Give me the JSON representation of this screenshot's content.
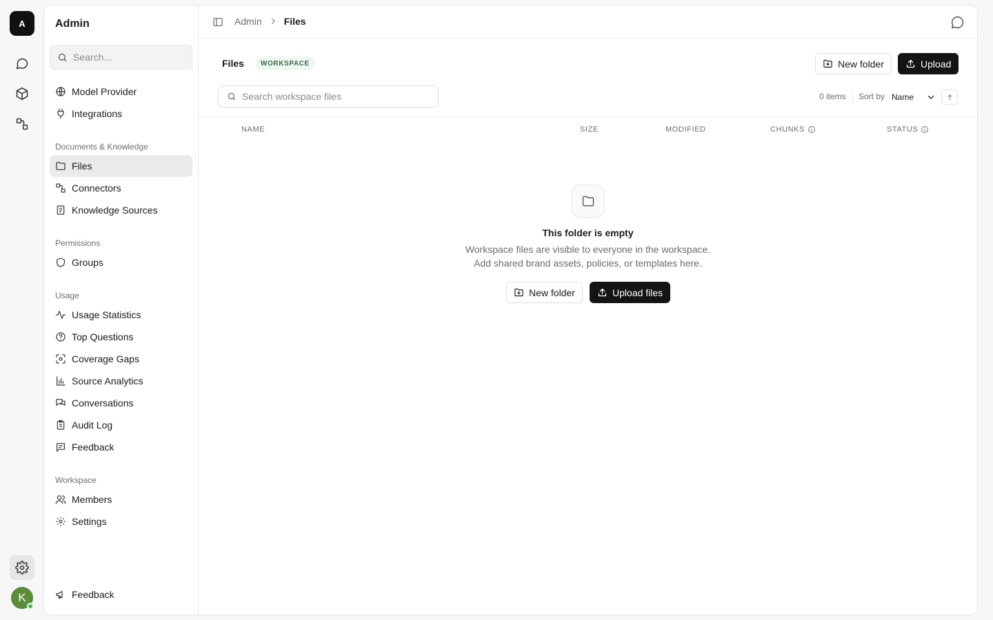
{
  "rail": {
    "logo_letter": "A",
    "avatar_letter": "K"
  },
  "sidebar": {
    "title": "Admin",
    "search_placeholder": "Search...",
    "top_items": [
      {
        "label": "Model Provider",
        "icon": "globe-icon"
      },
      {
        "label": "Integrations",
        "icon": "plug-icon"
      }
    ],
    "sections": [
      {
        "title": "Documents & Knowledge",
        "items": [
          {
            "label": "Files",
            "icon": "folder-icon",
            "active": true
          },
          {
            "label": "Connectors",
            "icon": "connectors-icon"
          },
          {
            "label": "Knowledge Sources",
            "icon": "book-icon"
          }
        ]
      },
      {
        "title": "Permissions",
        "items": [
          {
            "label": "Groups",
            "icon": "shield-icon"
          }
        ]
      },
      {
        "title": "Usage",
        "items": [
          {
            "label": "Usage Statistics",
            "icon": "activity-icon"
          },
          {
            "label": "Top Questions",
            "icon": "question-icon"
          },
          {
            "label": "Coverage Gaps",
            "icon": "scan-icon"
          },
          {
            "label": "Source Analytics",
            "icon": "bar-chart-icon"
          },
          {
            "label": "Conversations",
            "icon": "chat-bubbles-icon"
          },
          {
            "label": "Audit Log",
            "icon": "clipboard-icon"
          },
          {
            "label": "Feedback",
            "icon": "message-square-icon"
          }
        ]
      },
      {
        "title": "Workspace",
        "items": [
          {
            "label": "Members",
            "icon": "users-icon"
          },
          {
            "label": "Settings",
            "icon": "gear-icon"
          }
        ]
      }
    ],
    "footer_item": {
      "label": "Feedback",
      "icon": "megaphone-icon"
    }
  },
  "breadcrumb": {
    "root": "Admin",
    "current": "Files"
  },
  "page": {
    "title": "Files",
    "badge": "WORKSPACE",
    "new_folder_label": "New folder",
    "upload_label": "Upload",
    "search_placeholder": "Search workspace files",
    "items_count": "0 items",
    "sort_by_label": "Sort by",
    "sort_value": "Name"
  },
  "table": {
    "columns": [
      "NAME",
      "SIZE",
      "MODIFIED",
      "CHUNKS",
      "STATUS"
    ]
  },
  "empty_state": {
    "title": "This folder is empty",
    "line1": "Workspace files are visible to everyone in the workspace.",
    "line2": "Add shared brand assets, policies, or templates here.",
    "new_folder_label": "New folder",
    "upload_label": "Upload files"
  },
  "colors": {
    "primary_dark": "#141414",
    "badge_bg": "#eef7f1",
    "badge_text": "#3d6b4a",
    "avatar": "#5b8c3a",
    "online": "#3fbf4f"
  }
}
